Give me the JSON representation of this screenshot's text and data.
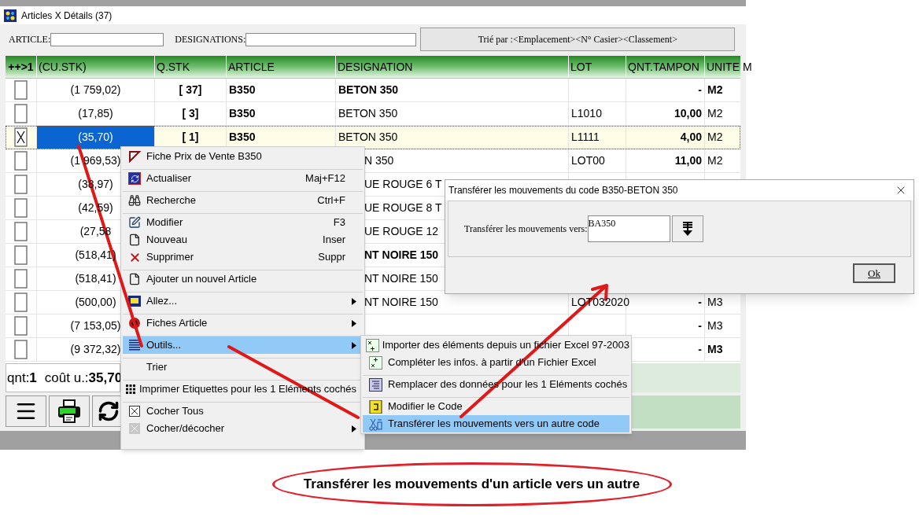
{
  "window": {
    "title": "Articles X Détails (37)"
  },
  "filters": [
    {
      "label": "ARTICLE:"
    },
    {
      "label": "DESIGNATIONS:"
    }
  ],
  "sort_button": "Trié par :<Emplacement><N° Casier><Classement>",
  "table": {
    "columns": [
      "++>1",
      "(CU.STK)",
      "Q.STK",
      "ARTICLE",
      "DESIGNATION",
      "LOT",
      "QNT.TAMPON",
      "UNITE M"
    ],
    "rows": [
      {
        "kind": "full",
        "checked": false,
        "selected": false,
        "bold": true,
        "cells": {
          "cu_stk": "(1 759,02)",
          "q_stk": "[ 37]",
          "article": "B350",
          "designation": "BETON 350",
          "qnt_tampon": "-",
          "unite": "M2"
        }
      },
      {
        "kind": "full",
        "checked": false,
        "selected": false,
        "bold": false,
        "cells": {
          "cu_stk": "(17,85)",
          "q_stk": "[ 3]",
          "article": "B350",
          "designation": "BETON 350",
          "lot": "L1010",
          "qnt_tampon": "10,00",
          "unite": "M2"
        }
      },
      {
        "kind": "full",
        "checked": true,
        "selected": true,
        "bold": false,
        "cells": {
          "cu_stk": "(35,70)",
          "q_stk": "[ 1]",
          "article": "B350",
          "designation": "BETON 350",
          "lot": "L1111",
          "qnt_tampon": "4,00",
          "unite": "M2"
        }
      },
      {
        "kind": "under_menu",
        "checked": false,
        "selected": false,
        "bold": false,
        "cells": {
          "cu_stk": "(1 969,53)",
          "designation": "N 350",
          "lot": "LOT00",
          "qnt_tampon": "11,00",
          "unite": "M2"
        }
      },
      {
        "kind": "under_menu",
        "checked": false,
        "selected": false,
        "bold": false,
        "cells": {
          "cu_stk": "(38,97)",
          "designation": "UE ROUGE 6 T"
        }
      },
      {
        "kind": "under_menu",
        "checked": false,
        "selected": false,
        "bold": false,
        "cells": {
          "cu_stk": "(42,59)",
          "designation": "UE ROUGE 8 T"
        }
      },
      {
        "kind": "under_menu",
        "checked": false,
        "selected": false,
        "bold": false,
        "cells": {
          "cu_stk": "(27,58",
          "designation": "UE ROUGE 12"
        }
      },
      {
        "kind": "under_menu",
        "checked": false,
        "selected": false,
        "bold": true,
        "cells": {
          "cu_stk": "(518,41)",
          "designation": "NT NOIRE 150"
        }
      },
      {
        "kind": "under_menu",
        "checked": false,
        "selected": false,
        "bold": false,
        "cells": {
          "cu_stk": "(518,41)",
          "designation": "NT NOIRE 150"
        }
      },
      {
        "kind": "under_menu",
        "checked": false,
        "selected": false,
        "bold": false,
        "cells": {
          "cu_stk": "(500,00)",
          "designation": "NT NOIRE 150",
          "lot": "LOT032020",
          "qnt_tampon": "-",
          "unite": "M3"
        }
      },
      {
        "kind": "under_menu",
        "checked": false,
        "selected": false,
        "bold": false,
        "cells": {
          "cu_stk": "(7 153,05)",
          "qnt_tampon": "-",
          "unite": "M3"
        }
      },
      {
        "kind": "under_menu",
        "checked": false,
        "selected": false,
        "bold": true,
        "cells": {
          "cu_stk": "(9 372,32)",
          "qnt_tampon": "-",
          "unite": "M3"
        }
      }
    ]
  },
  "status": [
    "qnt:**1**",
    "coût u.:**35,70**"
  ],
  "context_menu": [
    {
      "label": "Fiche Prix de Vente B350",
      "separator_before": false,
      "submenu": false,
      "selected": false
    },
    {
      "label": "Actualiser",
      "shortcut": "Maj+F12",
      "separator_before": true,
      "submenu": false,
      "selected": false
    },
    {
      "label": "Recherche",
      "shortcut": "Ctrl+F",
      "separator_before": true,
      "submenu": false,
      "selected": false
    },
    {
      "label": "Modifier",
      "shortcut": "F3",
      "separator_before": true,
      "submenu": false,
      "selected": false
    },
    {
      "label": "Nouveau",
      "shortcut": "Inser",
      "separator_before": false,
      "submenu": false,
      "selected": false
    },
    {
      "label": "Supprimer",
      "shortcut": "Suppr",
      "separator_before": false,
      "submenu": false,
      "selected": false
    },
    {
      "label": "Ajouter un nouvel Article",
      "separator_before": true,
      "submenu": false,
      "selected": false
    },
    {
      "label": "Allez...",
      "separator_before": true,
      "submenu": true,
      "selected": false
    },
    {
      "label": "Fiches Article",
      "separator_before": true,
      "submenu": true,
      "selected": false
    },
    {
      "label": "Outils...",
      "separator_before": true,
      "submenu": true,
      "selected": true
    },
    {
      "label": "Trier",
      "separator_before": true,
      "submenu": false,
      "selected": false
    },
    {
      "label": "Imprimer Etiquettes pour les 1 Eléments cochés",
      "separator_before": true,
      "submenu": false,
      "selected": false
    },
    {
      "label": "Cocher Tous",
      "separator_before": true,
      "submenu": false,
      "selected": false
    },
    {
      "label": "Cocher/décocher",
      "separator_before": false,
      "submenu": true,
      "selected": false
    }
  ],
  "submenu": [
    {
      "label": "Importer des éléments depuis un fichier Excel 97-2003",
      "separator_before": false,
      "selected": false
    },
    {
      "label": "Compléter les infos. à partir d'un Fichier Excel",
      "separator_before": false,
      "selected": false
    },
    {
      "label": "Remplacer des données pour les 1 Eléments cochés",
      "separator_before": true,
      "selected": false
    },
    {
      "label": "Modifier le Code",
      "separator_before": true,
      "selected": false
    },
    {
      "label": "Transférer les mouvements vers un autre code",
      "separator_before": false,
      "selected": true
    }
  ],
  "dialog": {
    "title": "Transférer les mouvements du code B350-BETON 350",
    "label": "Transférer les mouvements vers:",
    "value": "BA350",
    "ok": "Ok"
  },
  "callout": "Transférer les mouvements d'un article vers un autre"
}
